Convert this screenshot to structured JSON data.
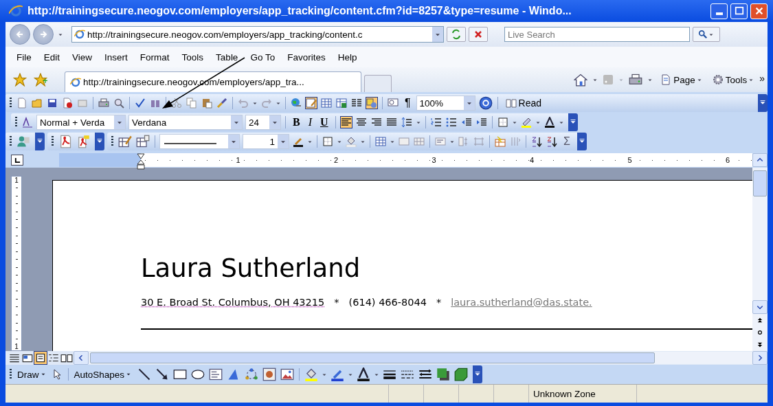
{
  "window": {
    "title": "http://trainingsecure.neogov.com/employers/app_tracking/content.cfm?id=8257&type=resume - Windo..."
  },
  "address_bar": {
    "url": "http://trainingsecure.neogov.com/employers/app_tracking/content.c",
    "search": {
      "placeholder": "Live Search"
    }
  },
  "menu": [
    "File",
    "Edit",
    "View",
    "Insert",
    "Format",
    "Tools",
    "Table",
    "Go To",
    "Favorites",
    "Help"
  ],
  "tabs": [
    {
      "label": "http://trainingsecure.neogov.com/employers/app_tra...",
      "selected": true
    }
  ],
  "command_bar": {
    "page": "Page",
    "tools": "Tools",
    "more": "»"
  },
  "standard_toolbar": {
    "pilcrow": "¶",
    "zoom": "100%",
    "read": "Read",
    "tables_and_borders_on": true,
    "drawing_on": true
  },
  "formatting_toolbar": {
    "style": "Normal + Verda",
    "font": "Verdana",
    "size": "24",
    "bold": "B",
    "italic": "I",
    "underline": "U",
    "alignments": [
      {
        "selected": true
      },
      {
        "selected": false
      },
      {
        "selected": false
      },
      {
        "selected": false
      }
    ]
  },
  "tables_toolbar": {
    "line_weight": "1",
    "sum": "Σ"
  },
  "ruler": {
    "numbers": [
      "1",
      "2",
      "3",
      "4",
      "5",
      "6"
    ]
  },
  "vertical_ruler": {
    "numbers": [
      "1",
      "1"
    ]
  },
  "document": {
    "name": "Laura Sutherland",
    "address": "30 E. Broad St. Columbus, OH 43215",
    "contact": [
      "*",
      "(614) 466-8044",
      "*"
    ],
    "email": "laura.sutherland@das.state."
  },
  "view_buttons": [
    {
      "selected": false
    },
    {
      "selected": false
    },
    {
      "selected": true
    },
    {
      "selected": false
    },
    {
      "selected": false
    }
  ],
  "drawing_toolbar": {
    "draw": "Draw",
    "autoshapes": "AutoShapes"
  },
  "status_bar": {
    "zone": "Unknown Zone"
  }
}
